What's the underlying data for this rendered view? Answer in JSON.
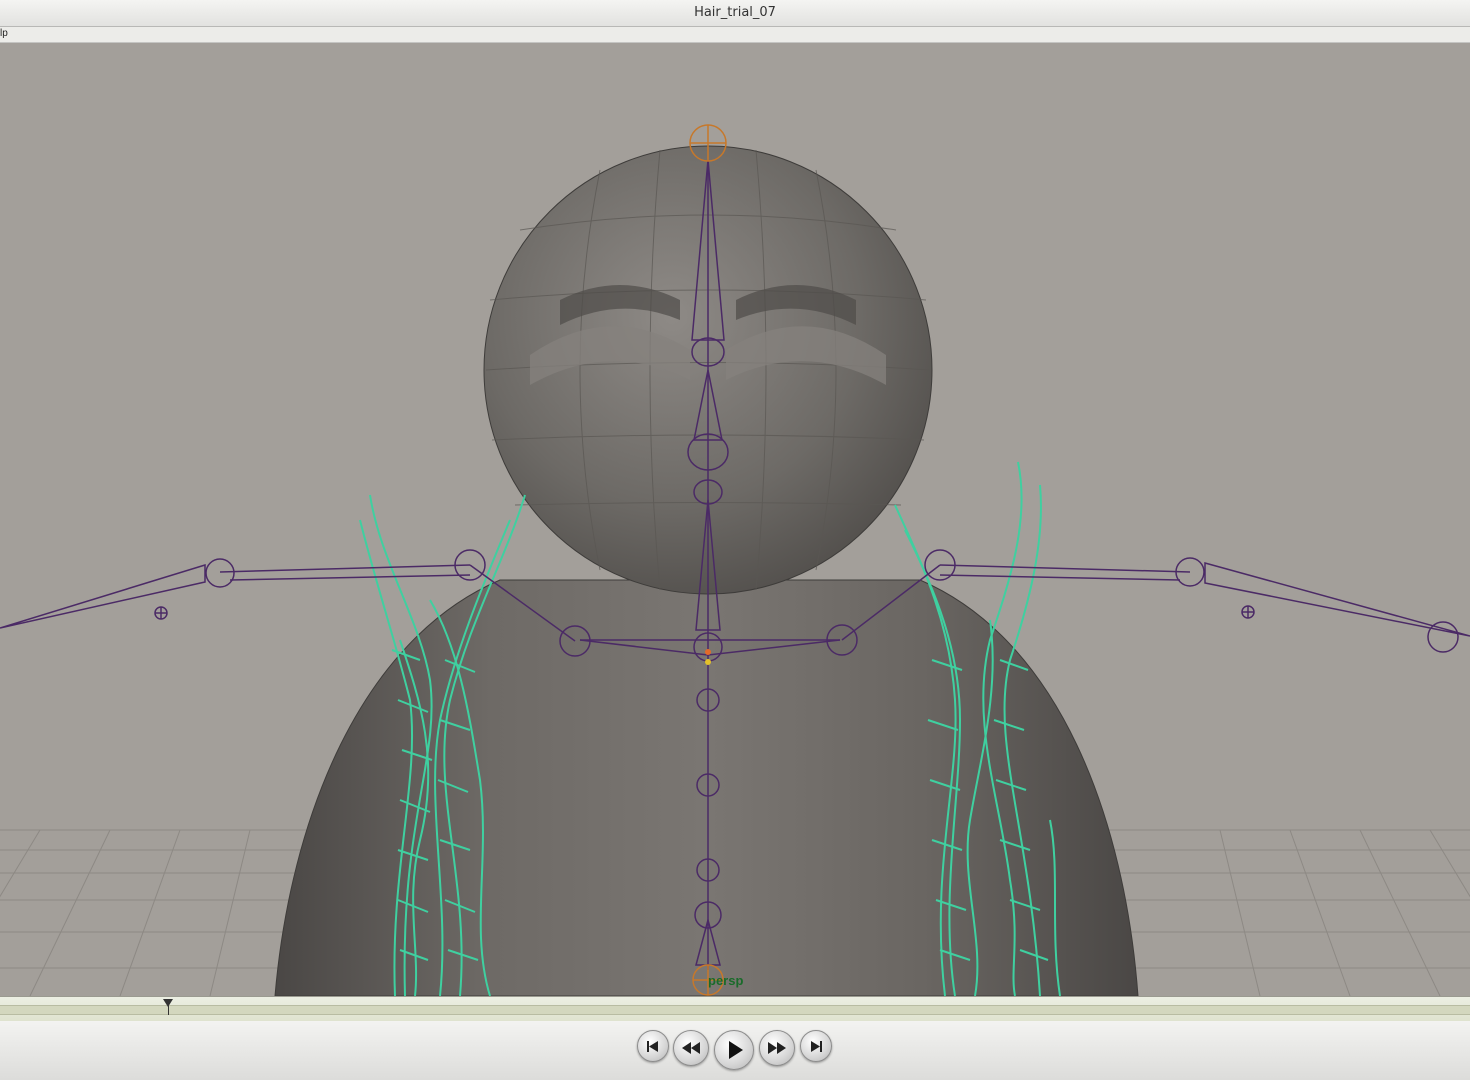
{
  "window": {
    "title": "Hair_trial_07"
  },
  "menubar": {
    "visible_label": "lp"
  },
  "viewport": {
    "camera_label": "persp",
    "colors": {
      "background": "#a39f9a",
      "mesh": "#6b6864",
      "hair_wire": "#3fd0a0",
      "joints": "#4b2a66",
      "root_joint": "#c7782a"
    }
  },
  "playback": {
    "buttons": [
      {
        "name": "go-to-start-button",
        "icon": "skip-back-icon"
      },
      {
        "name": "step-back-button",
        "icon": "rewind-icon"
      },
      {
        "name": "play-button",
        "icon": "play-icon"
      },
      {
        "name": "step-forward-button",
        "icon": "fast-forward-icon"
      },
      {
        "name": "go-to-end-button",
        "icon": "skip-forward-icon"
      }
    ]
  }
}
